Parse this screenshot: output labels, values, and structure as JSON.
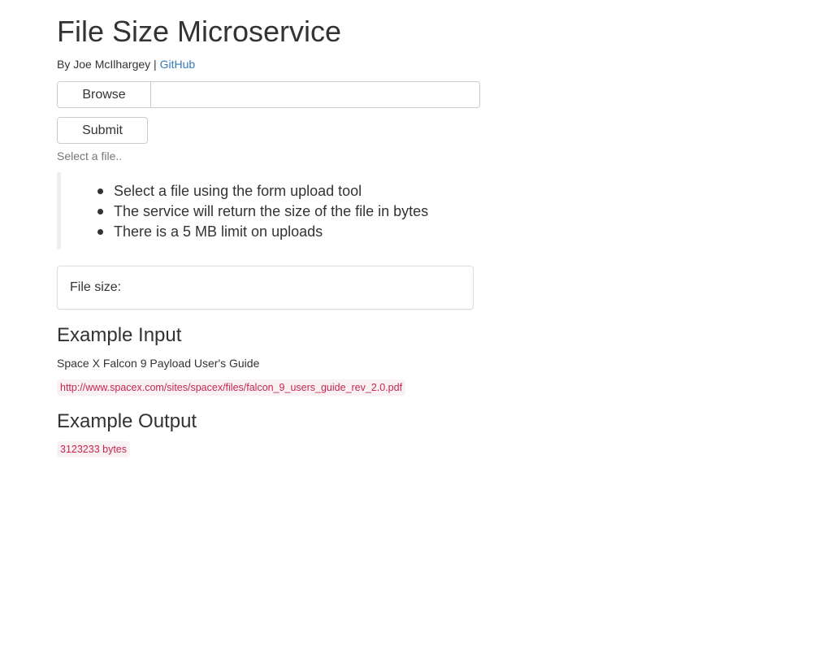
{
  "header": {
    "title": "File Size Microservice",
    "byline_prefix": "By Joe McIlhargey |",
    "github_link": "GitHub"
  },
  "upload_form": {
    "browse_label": "Browse",
    "file_value": "",
    "submit_label": "Submit",
    "help_text": "Select a file.."
  },
  "instructions": [
    "Select a file using the form upload tool",
    "The service will return the size of the file in bytes",
    "There is a 5 MB limit on uploads"
  ],
  "result": {
    "label": "File size:",
    "value": ""
  },
  "example_input": {
    "heading": "Example Input",
    "description": "Space X Falcon 9 Payload User's Guide",
    "url": "http://www.spacex.com/sites/spacex/files/falcon_9_users_guide_rev_2.0.pdf"
  },
  "example_output": {
    "heading": "Example Output",
    "value": "3123233 bytes"
  },
  "colors": {
    "link": "#337ab7",
    "code_text": "#c7254e",
    "code_bg": "#f9f2f4",
    "muted_text": "#777777",
    "border": "#cccccc"
  }
}
